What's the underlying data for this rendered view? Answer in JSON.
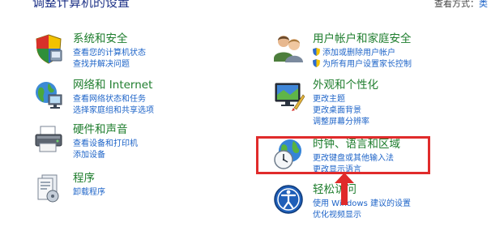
{
  "page": {
    "title": "调整计算机的设置"
  },
  "view_by": {
    "label": "查看方式：",
    "value": "类"
  },
  "categories": [
    {
      "id": "system-security",
      "title": "系统和安全",
      "icon": "shield-icon",
      "links": [
        "查看您的计算机状态",
        "查找并解决问题"
      ]
    },
    {
      "id": "network-internet",
      "title": "网络和 Internet",
      "icon": "network-icon",
      "links": [
        "查看网络状态和任务",
        "选择家庭组和共享选项"
      ]
    },
    {
      "id": "hardware-sound",
      "title": "硬件和声音",
      "icon": "printer-icon",
      "links": [
        "查看设备和打印机",
        "添加设备"
      ]
    },
    {
      "id": "programs",
      "title": "程序",
      "icon": "programs-icon",
      "links": [
        "卸载程序"
      ]
    },
    {
      "id": "user-accounts",
      "title": "用户帐户和家庭安全",
      "icon": "users-icon",
      "links": [
        "添加或删除用户帐户",
        "为所有用户设置家长控制"
      ]
    },
    {
      "id": "appearance",
      "title": "外观和个性化",
      "icon": "appearance-icon",
      "links": [
        "更改主题",
        "更改桌面背景",
        "调整屏幕分辨率"
      ]
    },
    {
      "id": "clock-language-region",
      "title": "时钟、语言和区域",
      "icon": "globe-clock-icon",
      "links": [
        "更改键盘或其他输入法",
        "更改显示语言"
      ]
    },
    {
      "id": "ease-of-access",
      "title": "轻松访问",
      "icon": "ease-of-access-icon",
      "links": [
        "使用 Windows 建议的设置",
        "优化视频显示"
      ]
    }
  ],
  "annotation": {
    "box_color": "#e02b2b",
    "arrow_color": "#e02b2b"
  },
  "colors": {
    "category_title": "#1e7d2d",
    "link": "#1e64c8",
    "page_title": "#1e3287"
  }
}
